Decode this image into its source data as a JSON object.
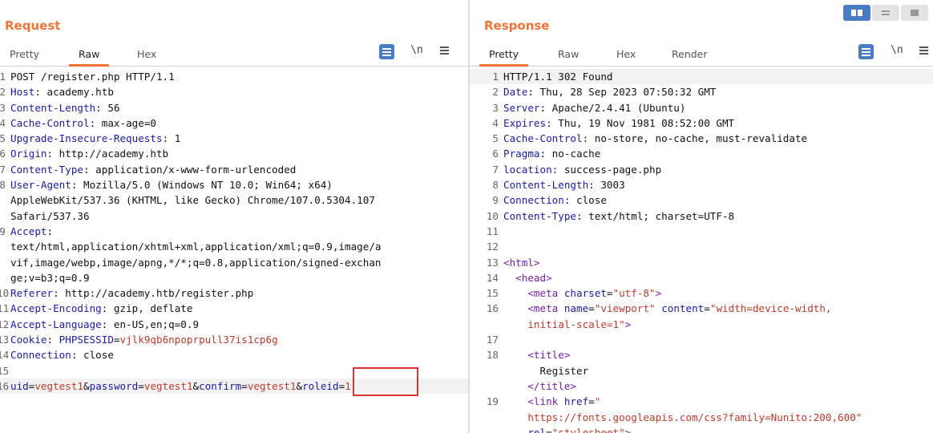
{
  "request": {
    "title": "Request",
    "tabs": [
      "Pretty",
      "Raw",
      "Hex"
    ],
    "active_tab": "Raw",
    "toolbar": {
      "newline_label": "\\n"
    },
    "lines": [
      {
        "n": "1",
        "parts": [
          [
            "t",
            "POST /register.php HTTP/1.1"
          ]
        ]
      },
      {
        "n": "2",
        "parts": [
          [
            "k",
            "Host"
          ],
          [
            "t",
            ": academy.htb"
          ]
        ]
      },
      {
        "n": "3",
        "parts": [
          [
            "k",
            "Content-Length"
          ],
          [
            "t",
            ": 56"
          ]
        ]
      },
      {
        "n": "4",
        "parts": [
          [
            "k",
            "Cache-Control"
          ],
          [
            "t",
            ": max-age=0"
          ]
        ]
      },
      {
        "n": "5",
        "parts": [
          [
            "k",
            "Upgrade-Insecure-Requests"
          ],
          [
            "t",
            ": 1"
          ]
        ]
      },
      {
        "n": "6",
        "parts": [
          [
            "k",
            "Origin"
          ],
          [
            "t",
            ": http://academy.htb"
          ]
        ]
      },
      {
        "n": "7",
        "parts": [
          [
            "k",
            "Content-Type"
          ],
          [
            "t",
            ": application/x-www-form-urlencoded"
          ]
        ]
      },
      {
        "n": "8",
        "parts": [
          [
            "k",
            "User-Agent"
          ],
          [
            "t",
            ": Mozilla/5.0 (Windows NT 10.0; Win64; x64)\nAppleWebKit/537.36 (KHTML, like Gecko) Chrome/107.0.5304.107\nSafari/537.36"
          ]
        ]
      },
      {
        "n": "9",
        "parts": [
          [
            "k",
            "Accept"
          ],
          [
            "t",
            ":\ntext/html,application/xhtml+xml,application/xml;q=0.9,image/a\nvif,image/webp,image/apng,*/*;q=0.8,application/signed-exchan\nge;v=b3;q=0.9"
          ]
        ]
      },
      {
        "n": "10",
        "parts": [
          [
            "k",
            "Referer"
          ],
          [
            "t",
            ": http://academy.htb/register.php"
          ]
        ]
      },
      {
        "n": "11",
        "parts": [
          [
            "k",
            "Accept-Encoding"
          ],
          [
            "t",
            ": gzip, deflate"
          ]
        ]
      },
      {
        "n": "12",
        "parts": [
          [
            "k",
            "Accept-Language"
          ],
          [
            "t",
            ": en-US,en;q=0.9"
          ]
        ]
      },
      {
        "n": "13",
        "parts": [
          [
            "k",
            "Cookie"
          ],
          [
            "t",
            ": "
          ],
          [
            "k",
            "PHPSESSID"
          ],
          [
            "t",
            "="
          ],
          [
            "v",
            "vjlk9qb6npoprpull37is1cp6g"
          ]
        ]
      },
      {
        "n": "14",
        "parts": [
          [
            "k",
            "Connection"
          ],
          [
            "t",
            ": close"
          ]
        ]
      },
      {
        "n": "15",
        "parts": [
          [
            "t",
            ""
          ]
        ]
      },
      {
        "n": "16",
        "hl": true,
        "parts": [
          [
            "k",
            "uid"
          ],
          [
            "t",
            "="
          ],
          [
            "v",
            "vegtest1"
          ],
          [
            "t",
            "&"
          ],
          [
            "k",
            "password"
          ],
          [
            "t",
            "="
          ],
          [
            "v",
            "vegtest1"
          ],
          [
            "t",
            "&"
          ],
          [
            "k",
            "confirm"
          ],
          [
            "t",
            "="
          ],
          [
            "v",
            "vegtest1"
          ],
          [
            "t",
            "&"
          ],
          [
            "k",
            "roleid"
          ],
          [
            "t",
            "="
          ],
          [
            "v",
            "1"
          ]
        ]
      }
    ]
  },
  "response": {
    "title": "Response",
    "tabs": [
      "Pretty",
      "Raw",
      "Hex",
      "Render"
    ],
    "active_tab": "Pretty",
    "toolbar": {
      "newline_label": "\\n"
    },
    "lines": [
      {
        "n": "1",
        "hl": true,
        "parts": [
          [
            "t",
            "HTTP/1.1 302 Found"
          ]
        ]
      },
      {
        "n": "2",
        "parts": [
          [
            "k",
            "Date"
          ],
          [
            "t",
            ": Thu, 28 Sep 2023 07:50:32 GMT"
          ]
        ]
      },
      {
        "n": "3",
        "parts": [
          [
            "k",
            "Server"
          ],
          [
            "t",
            ": Apache/2.4.41 (Ubuntu)"
          ]
        ]
      },
      {
        "n": "4",
        "parts": [
          [
            "k",
            "Expires"
          ],
          [
            "t",
            ": Thu, 19 Nov 1981 08:52:00 GMT"
          ]
        ]
      },
      {
        "n": "5",
        "parts": [
          [
            "k",
            "Cache-Control"
          ],
          [
            "t",
            ": no-store, no-cache, must-revalidate"
          ]
        ]
      },
      {
        "n": "6",
        "parts": [
          [
            "k",
            "Pragma"
          ],
          [
            "t",
            ": no-cache"
          ]
        ]
      },
      {
        "n": "7",
        "parts": [
          [
            "k",
            "location"
          ],
          [
            "t",
            ": success-page.php"
          ]
        ]
      },
      {
        "n": "8",
        "parts": [
          [
            "k",
            "Content-Length"
          ],
          [
            "t",
            ": 3003"
          ]
        ]
      },
      {
        "n": "9",
        "parts": [
          [
            "k",
            "Connection"
          ],
          [
            "t",
            ": close"
          ]
        ]
      },
      {
        "n": "10",
        "parts": [
          [
            "k",
            "Content-Type"
          ],
          [
            "t",
            ": text/html; charset=UTF-8"
          ]
        ]
      },
      {
        "n": "11",
        "parts": [
          [
            "t",
            ""
          ]
        ]
      },
      {
        "n": "12",
        "parts": [
          [
            "t",
            ""
          ]
        ]
      },
      {
        "n": "13",
        "parts": [
          [
            "tag",
            "<html>"
          ]
        ]
      },
      {
        "n": "14",
        "parts": [
          [
            "t",
            "  "
          ],
          [
            "tag",
            "<head>"
          ]
        ]
      },
      {
        "n": "15",
        "parts": [
          [
            "t",
            "    "
          ],
          [
            "tag",
            "<meta "
          ],
          [
            "attr",
            "charset"
          ],
          [
            "t",
            "="
          ],
          [
            "str",
            "\"utf-8\""
          ],
          [
            "tag",
            ">"
          ]
        ]
      },
      {
        "n": "16",
        "parts": [
          [
            "t",
            "    "
          ],
          [
            "tag",
            "<meta "
          ],
          [
            "attr",
            "name"
          ],
          [
            "t",
            "="
          ],
          [
            "str",
            "\"viewport\""
          ],
          [
            "t",
            " "
          ],
          [
            "attr",
            "content"
          ],
          [
            "t",
            "="
          ],
          [
            "str",
            "\"width=device-width,\n    initial-scale=1\""
          ],
          [
            "tag",
            ">"
          ]
        ]
      },
      {
        "n": "17",
        "parts": [
          [
            "t",
            ""
          ]
        ]
      },
      {
        "n": "18",
        "parts": [
          [
            "t",
            "    "
          ],
          [
            "tag",
            "<title>"
          ],
          [
            "t",
            "\n      Register\n    "
          ],
          [
            "tag",
            "</title>"
          ]
        ]
      },
      {
        "n": "19",
        "parts": [
          [
            "t",
            "    "
          ],
          [
            "tag",
            "<link "
          ],
          [
            "attr",
            "href"
          ],
          [
            "t",
            "="
          ],
          [
            "str",
            "\"\n    https://fonts.googleapis.com/css?family=Nunito:200,600\""
          ],
          [
            "t",
            "\n    "
          ],
          [
            "attr",
            "rel"
          ],
          [
            "t",
            "="
          ],
          [
            "str",
            "\"stylesheet\""
          ],
          [
            "tag",
            ">"
          ]
        ]
      }
    ]
  }
}
